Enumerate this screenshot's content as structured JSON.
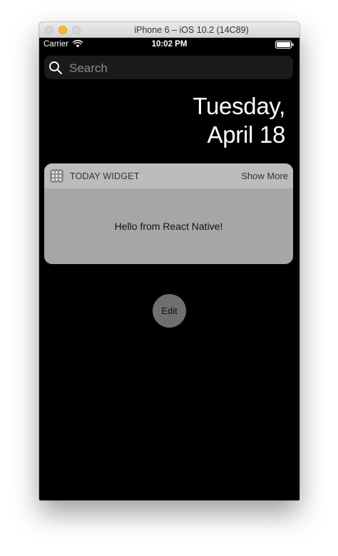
{
  "window": {
    "title": "iPhone 6 – iOS 10.2 (14C89)"
  },
  "status_bar": {
    "carrier": "Carrier",
    "time": "10:02 PM",
    "wifi_icon": "wifi-icon",
    "battery_icon": "battery-icon"
  },
  "search": {
    "placeholder": "Search",
    "icon": "search-icon"
  },
  "date": {
    "weekday": "Tuesday,",
    "month_day": "April 18"
  },
  "widget": {
    "title": "TODAY WIDGET",
    "show_more": "Show More",
    "message": "Hello from React Native!",
    "app_icon": "app-grid-icon"
  },
  "edit": {
    "label": "Edit"
  },
  "colors": {
    "screen_background": "#000000",
    "widget_body": "#a6a6a6",
    "widget_header": "#bcbcbc",
    "edit_button": "#6f6f6f",
    "minimize_light": "#f4bc2f"
  }
}
